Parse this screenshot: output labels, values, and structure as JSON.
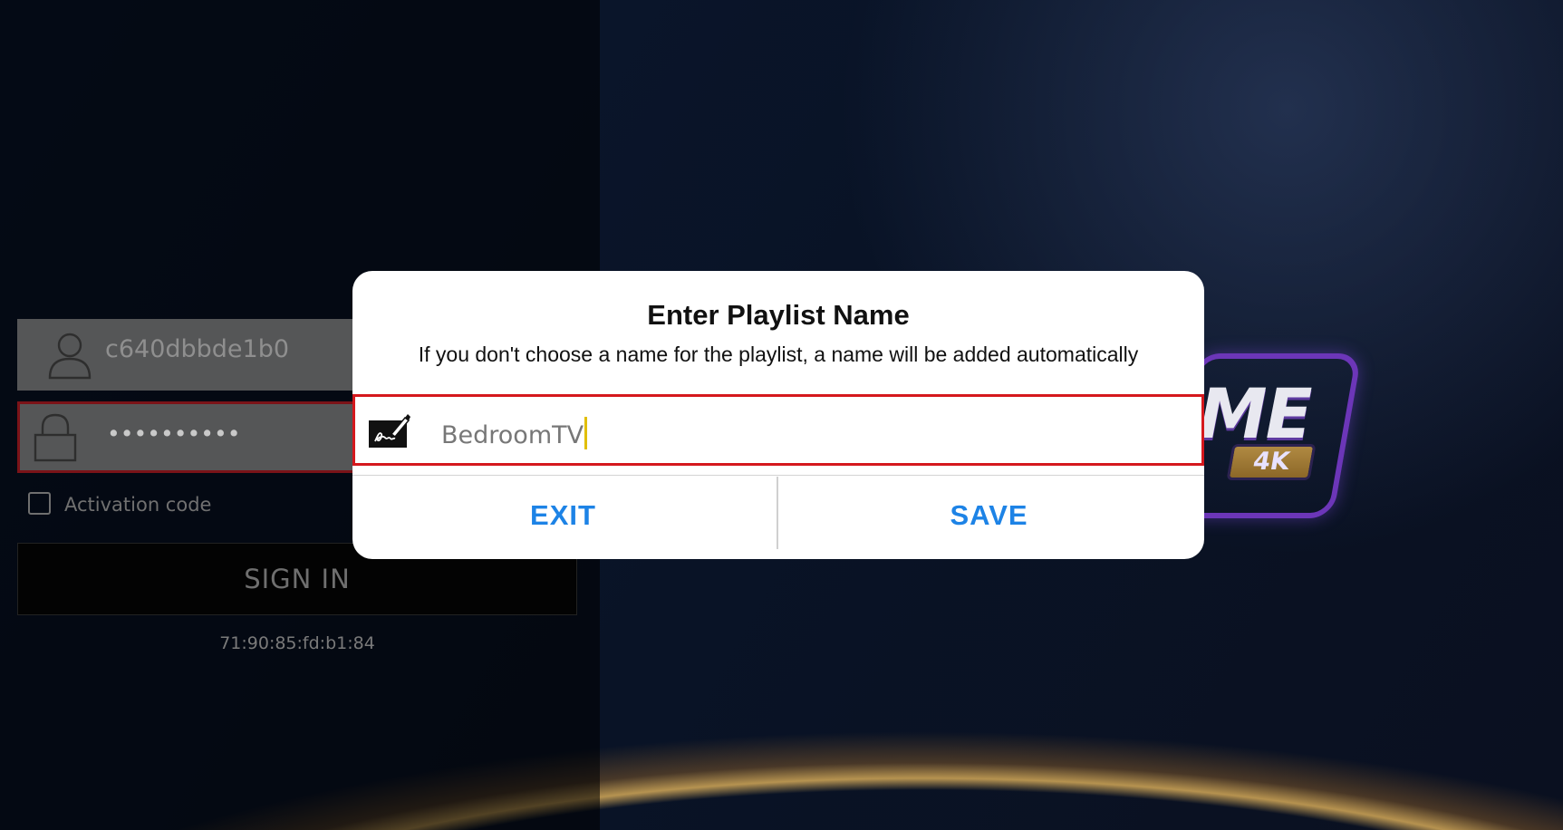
{
  "login": {
    "username_value": "c640dbbde1b0",
    "password_mask": "••••••••••",
    "activation_label": "Activation code",
    "sign_in_label": "SIGN IN",
    "mac_address": "71:90:85:fd:b1:84"
  },
  "logo": {
    "text": "ME",
    "badge": "4K"
  },
  "dialog": {
    "title": "Enter Playlist Name",
    "subtitle": "If you don't choose a name for the playlist, a name will be added automatically",
    "input_value": "BedroomTV",
    "exit_label": "EXIT",
    "save_label": "SAVE"
  },
  "colors": {
    "accent": "#1d83e6",
    "focus_border": "#d5181d",
    "cursor": "#e1be00"
  },
  "icons": {
    "username": "user-icon",
    "password": "lock-icon",
    "name_input": "signature-pen-icon"
  }
}
